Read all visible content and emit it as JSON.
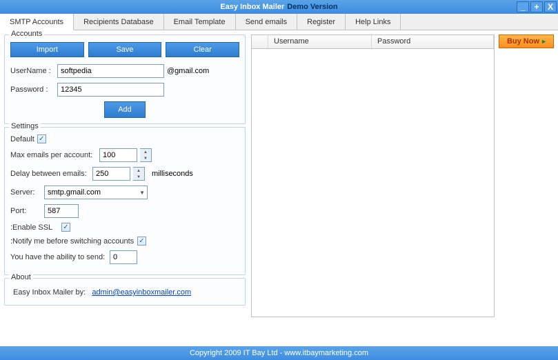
{
  "titlebar": {
    "app_name": "Easy Inbox Mailer",
    "version_label": "Demo Version"
  },
  "tabs": {
    "t0": "SMTP Accounts",
    "t1": "Recipients Database",
    "t2": "Email Template",
    "t3": "Send emails",
    "t4": "Register",
    "t5": "Help Links"
  },
  "accounts": {
    "legend": "Accounts",
    "import_btn": "Import",
    "save_btn": "Save",
    "clear_btn": "Clear",
    "username_label": "UserName :",
    "username_value": "softpedia",
    "domain_label": "@gmail.com",
    "password_label": "Password :",
    "password_value": "12345",
    "add_btn": "Add"
  },
  "settings": {
    "legend": "Settings",
    "default_label": "Default",
    "default_checked": "✓",
    "max_emails_label": "Max emails per account:",
    "max_emails_value": "100",
    "delay_label": "Delay between emails:",
    "delay_value": "250",
    "delay_unit": "milliseconds",
    "server_label": "Server:",
    "server_value": "smtp.gmail.com",
    "port_label": "Port:",
    "port_value": "587",
    "ssl_label": ":Enable SSL",
    "ssl_checked": "✓",
    "notify_label": ":Notify me before switching accounts",
    "notify_checked": "✓",
    "ability_label": "You have the ability to send:",
    "ability_value": "0"
  },
  "about": {
    "legend": "About",
    "prefix": "Easy Inbox Mailer by:",
    "link": "admin@easyinboxmailer.com"
  },
  "table": {
    "col_username": "Username",
    "col_password": "Password"
  },
  "buy_now": "Buy Now",
  "footer": "Copyright 2009 IT Bay Ltd  -  www.itbaymarketing.com"
}
